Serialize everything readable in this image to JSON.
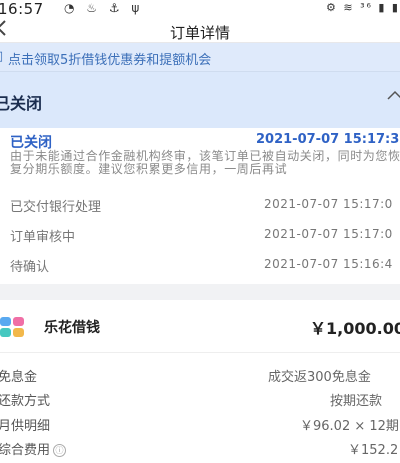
{
  "status_bar": {
    "time": "16:57",
    "left_icons": "◔ ♨ ⚓ ψ",
    "right_icons": "⚙ ≋ ³⁶ ▮ ▮"
  },
  "navbar": {
    "back_icon": "chevron-left-icon",
    "title": "订单详情"
  },
  "promo": {
    "icon": "speaker-icon",
    "text": "点击领取5折借钱优惠券和提额机会"
  },
  "order_status": {
    "label": "已关闭",
    "chevron": "^"
  },
  "timeline": {
    "current_status": "已关闭",
    "current_time": "2021-07-07 15:17:3",
    "description": "由于未能通过合作金融机构终审，该笔订单已被自动关闭，同时为您恢复分期乐额度。建议您积累更多信用，一周后再试",
    "steps": [
      {
        "label": "已交付银行处理",
        "time": "2021-07-07 15:17:0"
      },
      {
        "label": "订单审核中",
        "time": "2021-07-07 15:17:0"
      },
      {
        "label": "待确认",
        "time": "2021-07-07 15:16:4"
      }
    ]
  },
  "loan": {
    "product_name": "乐花借钱",
    "amount": "￥1,000.00",
    "rows": [
      {
        "label": "免息金",
        "value": "成交返300免息金"
      },
      {
        "label": "还款方式",
        "value": "按期还款"
      },
      {
        "label": "月供明细",
        "value": "￥96.02 × 12期"
      },
      {
        "label": "综合费用",
        "value": "￥152.2"
      }
    ],
    "info_icon": "ⓘ"
  },
  "colors": {
    "accent_blue": "#2f62c5",
    "header_bg": "#dbe8fb",
    "promo_bg": "#dfeafb"
  }
}
